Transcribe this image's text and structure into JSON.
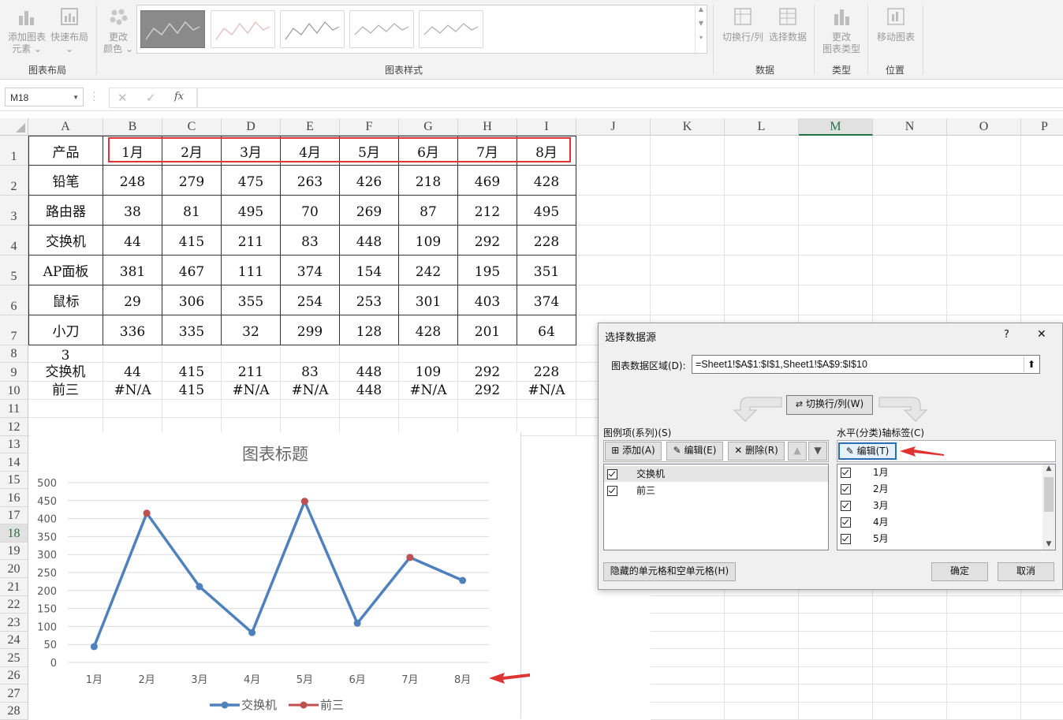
{
  "ribbon": {
    "buttons": [
      {
        "label1": "添加图表",
        "label2": "元素 ⌄"
      },
      {
        "label1": "快速布局",
        "label2": "⌄"
      },
      {
        "label1": "更改",
        "label2": "颜色 ⌄"
      },
      {
        "label1": "切换行/列",
        "label2": ""
      },
      {
        "label1": "选择数据",
        "label2": ""
      },
      {
        "label1": "更改",
        "label2": "图表类型"
      },
      {
        "label1": "移动图表",
        "label2": ""
      }
    ],
    "groups": [
      "图表布局",
      "图表样式",
      "数据",
      "类型",
      "位置"
    ]
  },
  "formula_bar": {
    "name_box": "M18",
    "fx": "fx",
    "value": ""
  },
  "columns": [
    "A",
    "B",
    "C",
    "D",
    "E",
    "F",
    "G",
    "H",
    "I",
    "J",
    "K",
    "L",
    "M",
    "N",
    "O",
    "P"
  ],
  "selected_column": "M",
  "rows": [
    "1",
    "2",
    "3",
    "4",
    "5",
    "6",
    "7",
    "8",
    "9",
    "10",
    "11",
    "12",
    "13",
    "14",
    "15",
    "16",
    "17",
    "18",
    "19",
    "20",
    "21",
    "22",
    "23",
    "24",
    "25",
    "26",
    "27",
    "28"
  ],
  "selected_row": "18",
  "table": {
    "header": [
      "产品",
      "1月",
      "2月",
      "3月",
      "4月",
      "5月",
      "6月",
      "7月",
      "8月"
    ],
    "body": [
      [
        "铅笔",
        "248",
        "279",
        "475",
        "263",
        "426",
        "218",
        "469",
        "428"
      ],
      [
        "路由器",
        "38",
        "81",
        "495",
        "70",
        "269",
        "87",
        "212",
        "495"
      ],
      [
        "交换机",
        "44",
        "415",
        "211",
        "83",
        "448",
        "109",
        "292",
        "228"
      ],
      [
        "AP面板",
        "381",
        "467",
        "111",
        "374",
        "154",
        "242",
        "195",
        "351"
      ],
      [
        "鼠标",
        "29",
        "306",
        "355",
        "254",
        "253",
        "301",
        "403",
        "374"
      ],
      [
        "小刀",
        "336",
        "335",
        "32",
        "299",
        "128",
        "428",
        "201",
        "64"
      ]
    ],
    "row8": [
      "3",
      "",
      "",
      "",
      "",
      "",
      "",
      "",
      ""
    ],
    "row9": [
      "交换机",
      "44",
      "415",
      "211",
      "83",
      "448",
      "109",
      "292",
      "228"
    ],
    "row10": [
      "前三",
      "#N/A",
      "415",
      "#N/A",
      "#N/A",
      "448",
      "#N/A",
      "292",
      "#N/A"
    ]
  },
  "chart_data": {
    "type": "line",
    "title": "图表标题",
    "categories": [
      "1月",
      "2月",
      "3月",
      "4月",
      "5月",
      "6月",
      "7月",
      "8月"
    ],
    "series": [
      {
        "name": "交换机",
        "values": [
          44,
          415,
          211,
          83,
          448,
          109,
          292,
          228
        ],
        "color": "#4f81bd"
      },
      {
        "name": "前三",
        "values": [
          null,
          415,
          null,
          null,
          448,
          null,
          292,
          null
        ],
        "color": "#c0504d"
      }
    ],
    "yticks": [
      "500",
      "450",
      "400",
      "350",
      "300",
      "250",
      "200",
      "150",
      "100",
      "50",
      "0"
    ],
    "ylim": [
      0,
      500
    ],
    "grid": true,
    "legend": "bottom"
  },
  "dialog": {
    "title": "选择数据源",
    "help": "?",
    "close": "✕",
    "range_label": "图表数据区域(D):",
    "range_value": "=Sheet1!$A$1:$I$1,Sheet1!$A$9:$I$10",
    "switch_label": "切换行/列(W)",
    "legend_label": "图例项(系列)(S)",
    "add": "添加(A)",
    "edit": "编辑(E)",
    "delete": "删除(R)",
    "series": [
      "交换机",
      "前三"
    ],
    "axis_label": "水平(分类)轴标签(C)",
    "axis_edit": "编辑(T)",
    "axis_items": [
      "1月",
      "2月",
      "3月",
      "4月",
      "5月"
    ],
    "hidden_cells": "隐藏的单元格和空单元格(H)",
    "ok": "确定",
    "cancel": "取消"
  }
}
